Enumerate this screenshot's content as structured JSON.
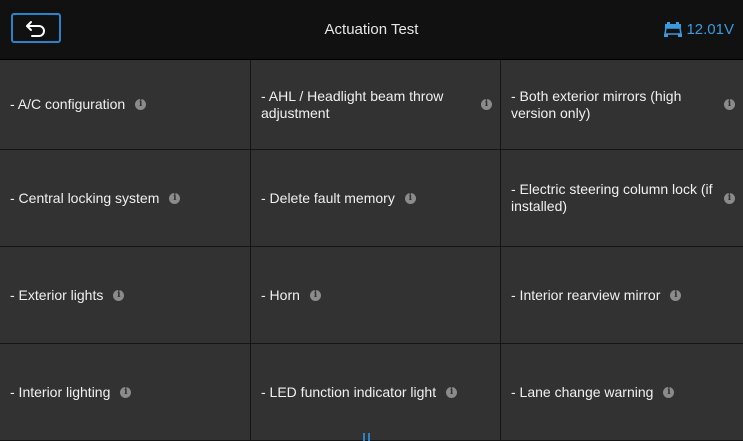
{
  "header": {
    "back_icon": "back-arrow-icon",
    "title": "Actuation Test",
    "battery_icon": "car-battery-icon",
    "voltage": "12.01V",
    "accent_color": "#2a83c8"
  },
  "items": [
    {
      "label": "- A/C configuration"
    },
    {
      "label": "- AHL / Headlight beam throw adjustment"
    },
    {
      "label": "- Both exterior mirrors (high version only)"
    },
    {
      "label": "- Central locking system"
    },
    {
      "label": "- Delete fault memory"
    },
    {
      "label": "- Electric steering column lock (if installed)"
    },
    {
      "label": "- Exterior lights"
    },
    {
      "label": "- Horn"
    },
    {
      "label": "- Interior rearview mirror"
    },
    {
      "label": "- Interior lighting"
    },
    {
      "label": "- LED function indicator light"
    },
    {
      "label": "- Lane change warning"
    }
  ],
  "info_icon": "info-icon"
}
